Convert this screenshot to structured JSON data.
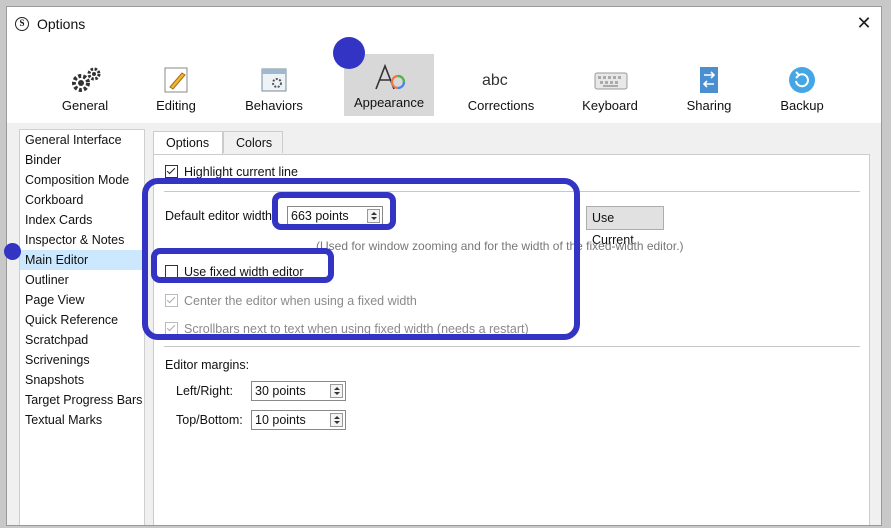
{
  "window": {
    "title": "Options",
    "close_glyph": "✕",
    "app_icon_letter": "S"
  },
  "toolbar": {
    "items": [
      {
        "label": "General",
        "icon": "gears-icon"
      },
      {
        "label": "Editing",
        "icon": "pencil-icon"
      },
      {
        "label": "Behaviors",
        "icon": "behaviors-icon"
      },
      {
        "label": "Appearance",
        "icon": "font-appearance-icon",
        "selected": true
      },
      {
        "label": "Corrections",
        "icon": "abc-icon"
      },
      {
        "label": "Keyboard",
        "icon": "keyboard-icon"
      },
      {
        "label": "Sharing",
        "icon": "sharing-icon"
      },
      {
        "label": "Backup",
        "icon": "backup-icon"
      }
    ]
  },
  "sidebar": {
    "items": [
      "General Interface",
      "Binder",
      "Composition Mode",
      "Corkboard",
      "Index Cards",
      "Inspector & Notes",
      "Main Editor",
      "Outliner",
      "Page View",
      "Quick Reference",
      "Scratchpad",
      "Scrivenings",
      "Snapshots",
      "Target Progress Bars",
      "Textual Marks"
    ],
    "selected": "Main Editor"
  },
  "tabs": [
    {
      "label": "Options",
      "active": true
    },
    {
      "label": "Colors"
    }
  ],
  "options": {
    "highlight_current_line": {
      "label": "Highlight current line",
      "checked": true
    },
    "default_width": {
      "label": "Default editor width",
      "value": "663 points",
      "button": "Use Current",
      "hint": "(Used for window zooming and for the width of the fixed-width editor.)"
    },
    "fixed_width": {
      "label": "Use fixed width editor",
      "checked": false
    },
    "center_editor": {
      "label": "Center the editor when using a fixed width",
      "checked": true,
      "disabled": true
    },
    "scrollbars": {
      "label": "Scrollbars next to text when using fixed width (needs a restart)",
      "checked": true,
      "disabled": true
    },
    "margins": {
      "title": "Editor margins:",
      "left_right": {
        "label": "Left/Right:",
        "value": "30 points"
      },
      "top_bottom": {
        "label": "Top/Bottom:",
        "value": "10 points"
      }
    }
  },
  "highlight_color": "#3434c4",
  "accent_selected_bg": "#cce8ff"
}
